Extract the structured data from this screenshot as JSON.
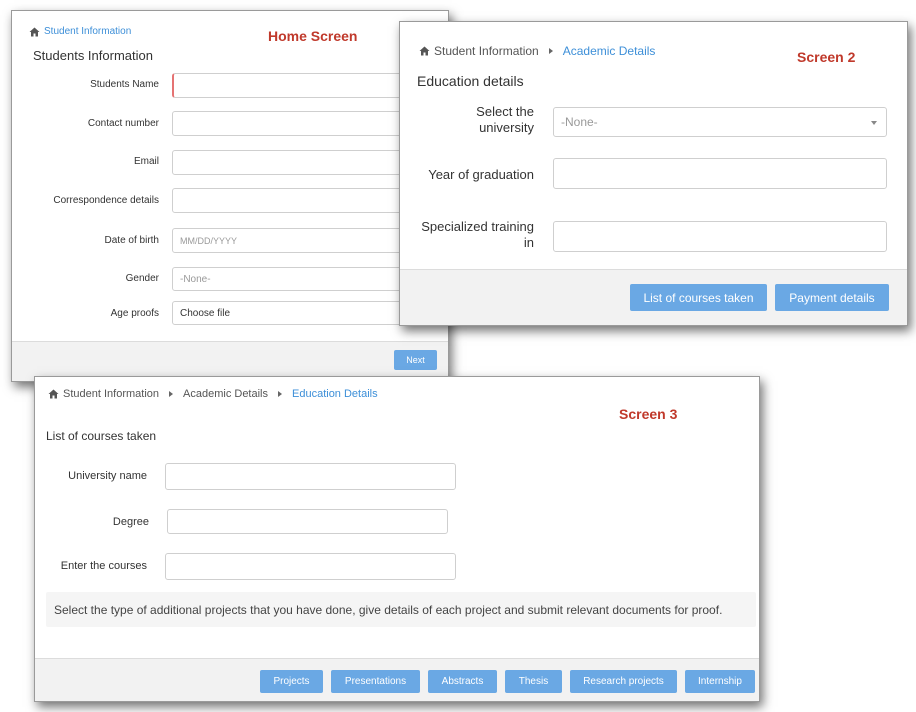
{
  "home": {
    "breadcrumb": "Student Information",
    "tag": "Home Screen",
    "title": "Students Information",
    "fields": {
      "name_label": "Students Name",
      "contact_label": "Contact number",
      "email_label": "Email",
      "correspondence_label": "Correspondence details",
      "dob_label": "Date of birth",
      "dob_placeholder": "MM/DD/YYYY",
      "gender_label": "Gender",
      "gender_value": "-None-",
      "age_label": "Age proofs",
      "age_value": "Choose file"
    },
    "next_label": "Next"
  },
  "screen2": {
    "breadcrumb": [
      "Student Information",
      "Academic Details"
    ],
    "tag": "Screen 2",
    "title": "Education details",
    "fields": {
      "university_label": "Select the university",
      "university_value": "-None-",
      "grad_label": "Year of graduation",
      "training_label": "Specialized training in"
    },
    "buttons": [
      "List of courses taken",
      "Payment details"
    ]
  },
  "screen3": {
    "breadcrumb": [
      "Student Information",
      "Academic Details",
      "Education Details"
    ],
    "tag": "Screen 3",
    "title": "List of courses taken",
    "fields": {
      "university_label": "University name",
      "degree_label": "Degree",
      "courses_label": "Enter the courses"
    },
    "info_text": "Select the type of additional projects that you have done, give details of each project and submit relevant documents for proof.",
    "buttons": [
      "Projects",
      "Presentations",
      "Abstracts",
      "Thesis",
      "Research projects",
      "Internship"
    ]
  },
  "colors": {
    "accent": "#6aa8e4",
    "link": "#3d8fd8",
    "tag": "#c0392b",
    "required": "#e57373"
  },
  "icons": {
    "home": "home-icon",
    "separator": "caret-right-icon",
    "dropdown": "chevron-down-icon"
  }
}
